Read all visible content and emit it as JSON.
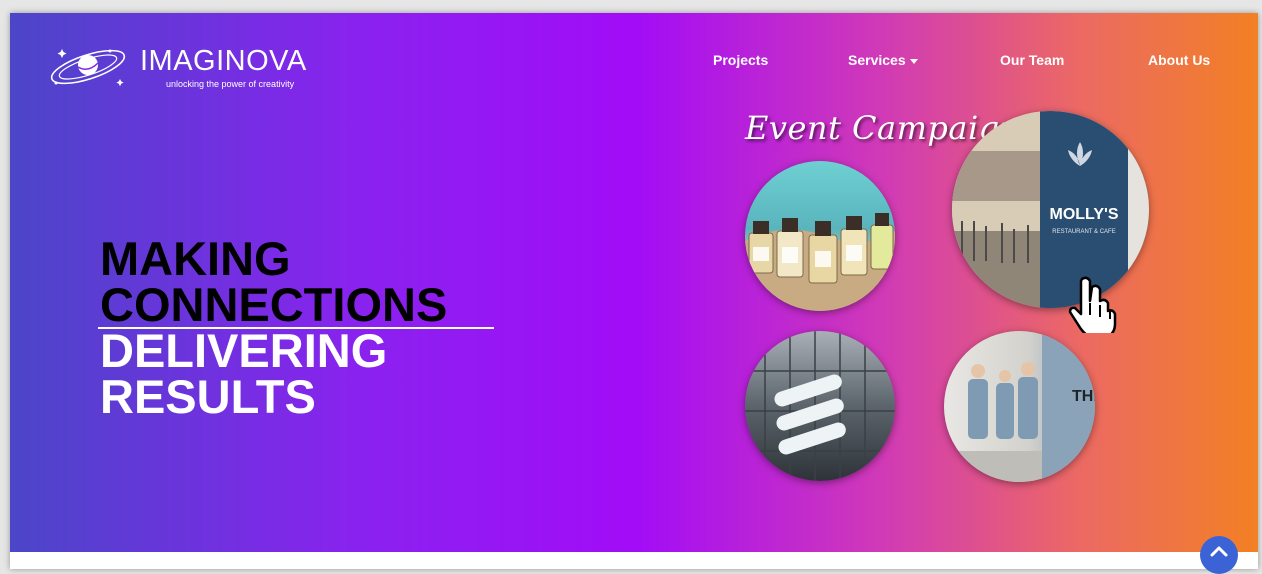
{
  "brand": {
    "name": "IMAGINOVA",
    "tagline": "unlocking the power of creativity"
  },
  "nav": {
    "items": [
      {
        "label": "Projects"
      },
      {
        "label": "Services"
      },
      {
        "label": "Our Team"
      },
      {
        "label": "About Us"
      }
    ]
  },
  "hero": {
    "line1": "MAKING",
    "line2": "CONNECTIONS",
    "line3": "DELIVERING",
    "line4": "RESULTS"
  },
  "campaign": {
    "title": "Event Campaign",
    "mollys_name": "MOLLY'S",
    "mollys_sub": "RESTAURANT & CAFE"
  },
  "colors": {
    "gradient_start": "#4b46c8",
    "gradient_mid": "#a20cf7",
    "gradient_end": "#f28024",
    "scroll_button": "#3c63d6"
  },
  "icons": {
    "logo": "planet-icon",
    "services_dropdown": "caret-down-icon",
    "cursor": "hand-pointer-icon",
    "scroll": "chevron-up-icon"
  }
}
